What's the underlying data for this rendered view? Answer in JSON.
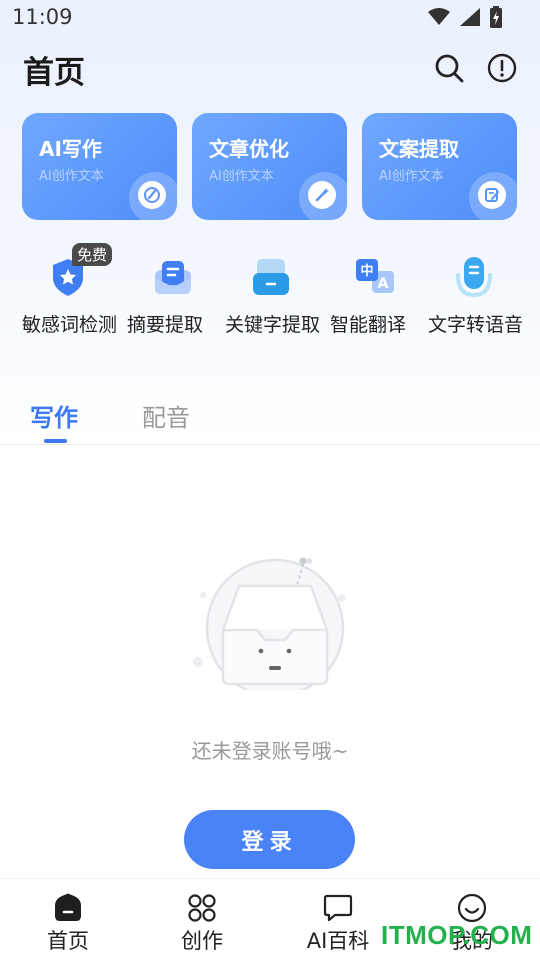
{
  "status_bar": {
    "time": "11:09"
  },
  "header": {
    "title": "首页"
  },
  "cards": [
    {
      "title": "AI写作",
      "subtitle": "AI创作文本",
      "icon": "pen-circle-icon"
    },
    {
      "title": "文章优化",
      "subtitle": "AI创作文本",
      "icon": "magic-wand-icon"
    },
    {
      "title": "文案提取",
      "subtitle": "AI创作文本",
      "icon": "note-edit-icon"
    }
  ],
  "tools": [
    {
      "label": "敏感词检测",
      "icon": "shield-star-icon",
      "badge": "免费"
    },
    {
      "label": "摘要提取",
      "icon": "inbox-list-icon"
    },
    {
      "label": "关键字提取",
      "icon": "tray-icon"
    },
    {
      "label": "智能翻译",
      "icon": "translate-icon"
    },
    {
      "label": "文字转语音",
      "icon": "microphone-icon"
    }
  ],
  "tabs": [
    {
      "label": "写作",
      "active": true
    },
    {
      "label": "配音",
      "active": false
    }
  ],
  "empty_state": {
    "message": "还未登录账号哦~",
    "button": "登录"
  },
  "bottom_nav": [
    {
      "label": "首页",
      "icon": "home-icon",
      "active": true
    },
    {
      "label": "创作",
      "icon": "grid-circles-icon"
    },
    {
      "label": "AI百科",
      "icon": "chat-bubble-icon"
    },
    {
      "label": "我的",
      "icon": "smiley-icon"
    }
  ],
  "watermark": "ITMOP.COM",
  "colors": {
    "primary": "#4a83f6",
    "tab_active": "#3d7af2",
    "card_gradient_start": "#6fa8ff",
    "card_gradient_end": "#4f8df9"
  }
}
